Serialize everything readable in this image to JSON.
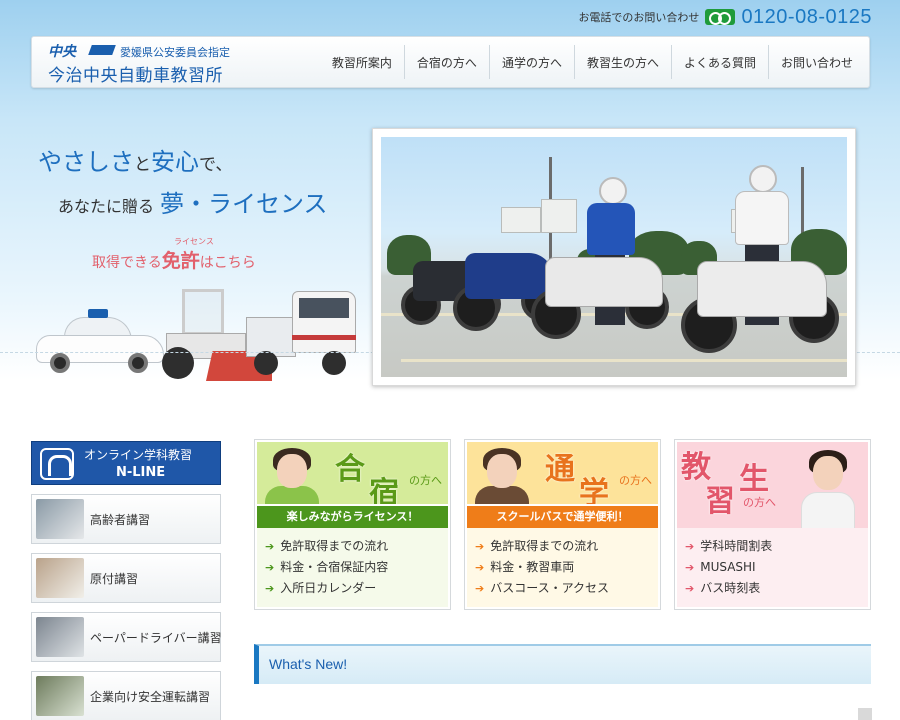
{
  "contact": {
    "label": "お電話でのお問い合わせ",
    "icon": "freedial-icon",
    "phone": "0120-08-0125",
    "accent": "#1a78c2"
  },
  "logo": {
    "mark": "中央",
    "subtitle": "愛媛県公安委員会指定",
    "name": "今治中央自動車教習所"
  },
  "nav": {
    "items": [
      {
        "label": "教習所案内"
      },
      {
        "label": "合宿の方へ"
      },
      {
        "label": "通学の方へ"
      },
      {
        "label": "教習生の方へ"
      },
      {
        "label": "よくある質問"
      },
      {
        "label": "お問い合わせ"
      }
    ]
  },
  "hero": {
    "line1_a": "やさしさ",
    "line1_b": "と",
    "line1_c": "安心",
    "line1_d": "で、",
    "line2_pre": "あなたに贈る",
    "line2_big": "夢・ライセンス",
    "license_ruby": "ライセンス",
    "license_pre": "取得できる",
    "license_big": "免許",
    "license_post": "はこちら"
  },
  "sidebar": {
    "banner_title": "オンライン学科教習",
    "banner_name": "N-LINE",
    "items": [
      {
        "label": "高齢者講習"
      },
      {
        "label": "原付講習"
      },
      {
        "label": "ペーパードライバー講習"
      },
      {
        "label": "企業向け安全運転講習"
      }
    ]
  },
  "cards": {
    "gassyuku": {
      "k1": "合",
      "k2": "宿",
      "suffix": "の方へ",
      "band": "楽しみながらライセンス！",
      "links": [
        "免許取得までの流れ",
        "料金・合宿保証内容",
        "入所日カレンダー"
      ],
      "color": "#4c961c"
    },
    "tsugaku": {
      "k1": "通",
      "k2": "学",
      "suffix": "の方へ",
      "band": "スクールバスで通学便利！",
      "links": [
        "免許取得までの流れ",
        "料金・教習車両",
        "バスコース・アクセス"
      ],
      "color": "#ef7d19"
    },
    "kyoshusei": {
      "k1": "教",
      "k2": "習",
      "k3": "生",
      "suffix": "の方へ",
      "links": [
        "学科時間割表",
        "MUSASHI",
        "バス時刻表"
      ],
      "color": "#e2566a"
    },
    "arrow": "➔"
  },
  "news": {
    "title": "What's New!"
  }
}
